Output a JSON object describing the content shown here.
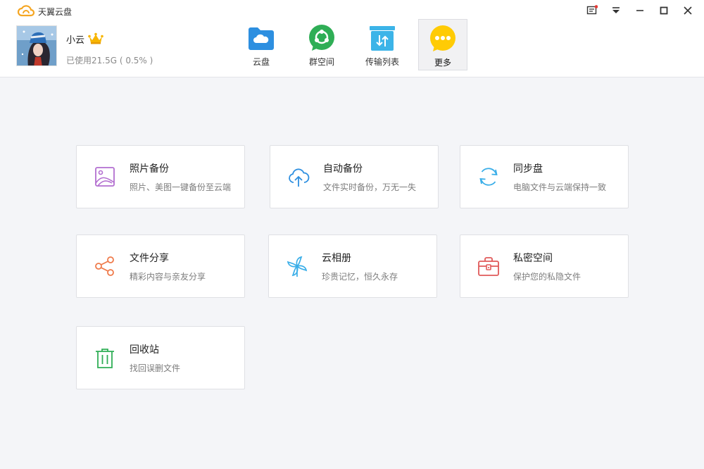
{
  "app": {
    "title": "天翼云盘"
  },
  "user": {
    "name": "小云",
    "usage": "已使用21.5G ( 0.5% )"
  },
  "nav": [
    {
      "label": "云盘",
      "icon": "cloud-folder-icon"
    },
    {
      "label": "群空间",
      "icon": "group-space-icon"
    },
    {
      "label": "传输列表",
      "icon": "transfer-list-icon"
    },
    {
      "label": "更多",
      "icon": "more-icon",
      "active": true
    }
  ],
  "features": [
    {
      "title": "照片备份",
      "desc": "照片、美图一键备份至云端",
      "icon": "photo-icon",
      "color": "#b36fd0"
    },
    {
      "title": "自动备份",
      "desc": "文件实时备份，万无一失",
      "icon": "cloud-upload-icon",
      "color": "#2d8fe0"
    },
    {
      "title": "同步盘",
      "desc": "电脑文件与云端保持一致",
      "icon": "sync-icon",
      "color": "#3aaee8"
    },
    {
      "title": "文件分享",
      "desc": "精彩内容与亲友分享",
      "icon": "share-icon",
      "color": "#ef7a4a"
    },
    {
      "title": "云相册",
      "desc": "珍贵记忆，恒久永存",
      "icon": "pinwheel-icon",
      "color": "#3aaee8"
    },
    {
      "title": "私密空间",
      "desc": "保护您的私隐文件",
      "icon": "lock-bag-icon",
      "color": "#e05a5a"
    },
    {
      "title": "回收站",
      "desc": "找回误删文件",
      "icon": "trash-icon",
      "color": "#2fae56"
    }
  ],
  "colors": {
    "accent_blue": "#2d8fe0",
    "accent_green": "#2fae56",
    "accent_yellow": "#ffcb05",
    "background": "#f4f5f8"
  }
}
